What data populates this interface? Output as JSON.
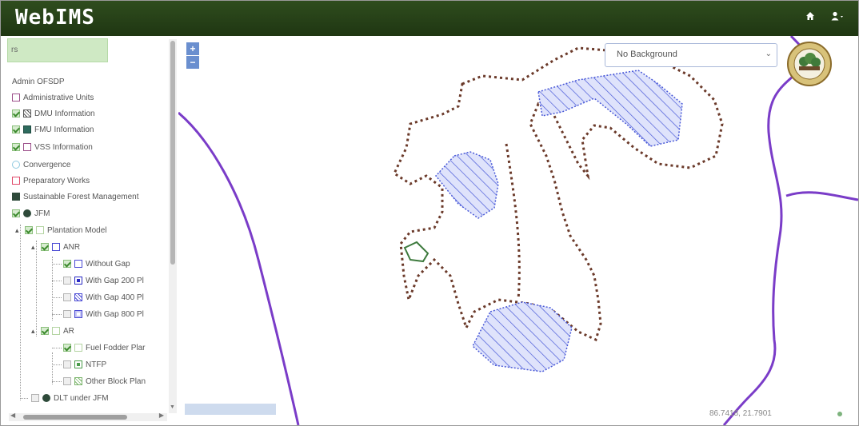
{
  "header": {
    "brand": "WebIMS",
    "home_icon": "home-icon",
    "user_icon": "user-icon"
  },
  "sidebar": {
    "search_text": "rs",
    "tree": [
      {
        "label": "Admin OFSDP",
        "level": 0,
        "checkbox": "none",
        "legend": "none"
      },
      {
        "label": "Administrative Units",
        "level": 0,
        "checkbox": "none",
        "legend": "#9c4f8b-outline"
      },
      {
        "label": "DMU Information",
        "level": 1,
        "checkbox": "on",
        "legend": "#555555-hatched"
      },
      {
        "label": "FMU Information",
        "level": 1,
        "checkbox": "on",
        "legend": "#2e6b5e-fill"
      },
      {
        "label": "VSS Information",
        "level": 1,
        "checkbox": "on",
        "legend": "#9c4f8b-outline"
      },
      {
        "label": "Convergence",
        "level": 0,
        "checkbox": "none",
        "legend": "#8fc9e0-circle"
      },
      {
        "label": "Preparatory Works",
        "level": 0,
        "checkbox": "none",
        "legend": "#e04a6a-outline"
      },
      {
        "label": "Sustainable Forest Management",
        "level": 0,
        "checkbox": "none",
        "legend": "#2e4a3a-fill"
      },
      {
        "label": "JFM",
        "level": 1,
        "checkbox": "on",
        "legend": "#2e4a3a-circle"
      },
      {
        "label": "Plantation Model",
        "level": 2,
        "checkbox": "on",
        "legend": "#b4d4a2-outline"
      },
      {
        "label": "ANR",
        "level": 3,
        "checkbox": "on",
        "legend": "#4a4ad4-outline"
      },
      {
        "label": "Without Gap",
        "level": 4,
        "checkbox": "on",
        "legend": "#4a4ad4-outline"
      },
      {
        "label": "With Gap 200 Pl",
        "level": 4,
        "checkbox": "off",
        "legend": "#2a2ac4-fill"
      },
      {
        "label": "With Gap 400 Pl",
        "level": 4,
        "checkbox": "off",
        "legend": "#4a4ad4-hatched"
      },
      {
        "label": "With Gap 800 Pl",
        "level": 4,
        "checkbox": "off",
        "legend": "#4a4ad4-outline"
      },
      {
        "label": "AR",
        "level": 3,
        "checkbox": "on",
        "legend": "#b4d4a2-outline"
      },
      {
        "label": "Fuel Fodder Plar",
        "level": 4,
        "checkbox": "on",
        "legend": "#b4d4a2-outline"
      },
      {
        "label": "NTFP",
        "level": 4,
        "checkbox": "off",
        "legend": "#4a9a4a-fill"
      },
      {
        "label": "Other Block Plan",
        "level": 4,
        "checkbox": "off",
        "legend": "#7ab46a-hatched"
      },
      {
        "label": "DLT under JFM",
        "level": 1,
        "checkbox": "off",
        "legend": "#2e4a3a-circle"
      }
    ]
  },
  "map": {
    "background_select": "No Background",
    "coordinates": "86.7418, 21.7901",
    "zoom_in": "+",
    "zoom_out": "−",
    "colors": {
      "boundary_purple": "#7a3cc8",
      "dotted_boundary": "#6b3a2a",
      "hatch_blue": "#4a5ad8",
      "green_poly": "#3d7a3d"
    }
  }
}
